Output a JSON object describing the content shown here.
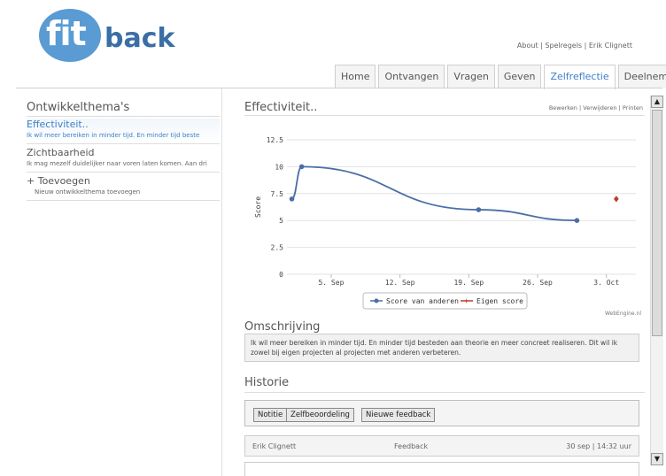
{
  "logo": {
    "fit": "fit",
    "back": "back"
  },
  "toplinks": {
    "about": "About",
    "rules": "Spelregels",
    "user": "Erik Clignett",
    "sep": " | "
  },
  "tabs": [
    {
      "label": "Home"
    },
    {
      "label": "Ontvangen"
    },
    {
      "label": "Vragen"
    },
    {
      "label": "Geven"
    },
    {
      "label": "Zelfreflectie",
      "active": true
    },
    {
      "label": "Deelnemers"
    }
  ],
  "sidebar": {
    "title": "Ontwikkelthema's",
    "items": [
      {
        "title": "Effectiviteit..",
        "desc": "Ik wil meer bereiken in minder tijd. En minder tijd beste"
      },
      {
        "title": "Zichtbaarheid",
        "desc": "Ik mag mezelf duidelijker naar voren laten komen. Aan dri"
      },
      {
        "title": "+ Toevoegen",
        "desc": "Nieuw ontwikkelthema toevoegen"
      }
    ]
  },
  "main": {
    "title": "Effectiviteit..",
    "actions": {
      "edit": "Bewerken",
      "delete": "Verwijderen",
      "print": "Printen",
      "sep": " | "
    },
    "watermark": "WebEngine.nl",
    "desc_title": "Omschrijving",
    "desc_text": "Ik wil meer bereiken in minder tijd. En minder tijd besteden aan theorie en meer concreet realiseren. Dit wil ik zowel bij eigen projecten al projecten met anderen verbeteren.",
    "hist_title": "Historie",
    "buttons": {
      "note": "Notitie",
      "self": "Zelfbeoordeling",
      "new": "Nieuwe feedback"
    },
    "row": {
      "name": "Erik Clignett",
      "type": "Feedback",
      "date": "30 sep | 14:32 uur"
    }
  },
  "colors": {
    "accent": "#3a7fc8",
    "series1": "#4a6fa5",
    "series2": "#c0392b"
  },
  "chart_data": {
    "type": "line",
    "ylabel": "Score",
    "ylim": [
      0,
      12.5
    ],
    "yticks": [
      "0",
      "2.5",
      "5",
      "7.5",
      "10",
      "12.5"
    ],
    "xticks": [
      "5. Sep",
      "12. Sep",
      "19. Sep",
      "26. Sep",
      "3. Oct"
    ],
    "series": [
      {
        "name": "Score van anderen",
        "color": "#4a6fa5",
        "points": [
          [
            "1 Sep",
            7
          ],
          [
            "2 Sep",
            10
          ],
          [
            "20 Sep",
            6
          ],
          [
            "30 Sep",
            5
          ]
        ]
      },
      {
        "name": "Eigen score",
        "color": "#c0392b",
        "points": [
          [
            "4 Oct",
            7
          ]
        ]
      }
    ]
  }
}
